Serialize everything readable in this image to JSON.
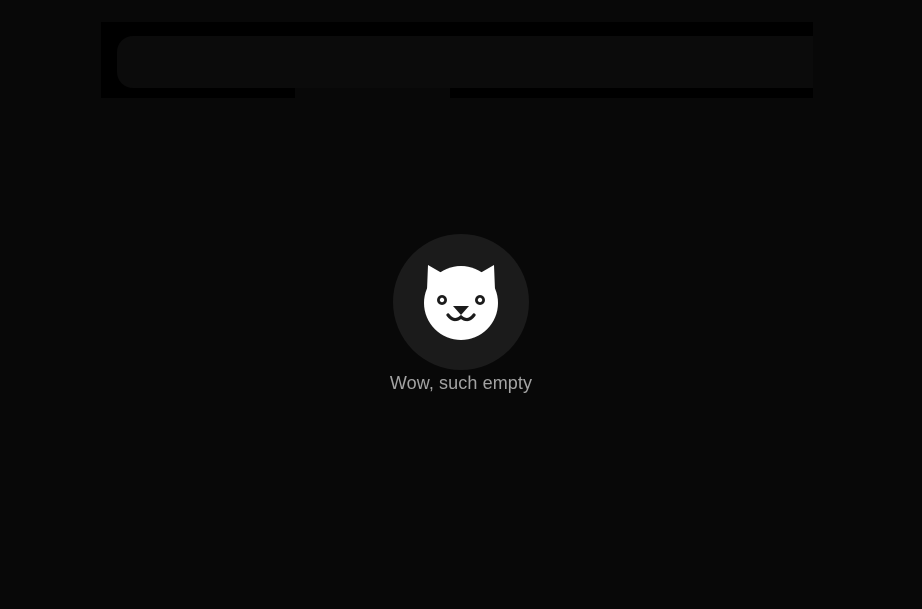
{
  "search": {
    "value": "",
    "placeholder": ""
  },
  "empty_state": {
    "icon": "cat-face-icon",
    "message": "Wow, such empty"
  },
  "colors": {
    "background": "#080808",
    "avatar_bg": "#1b1b1b",
    "icon": "#ffffff",
    "text": "#a3a3a3"
  }
}
